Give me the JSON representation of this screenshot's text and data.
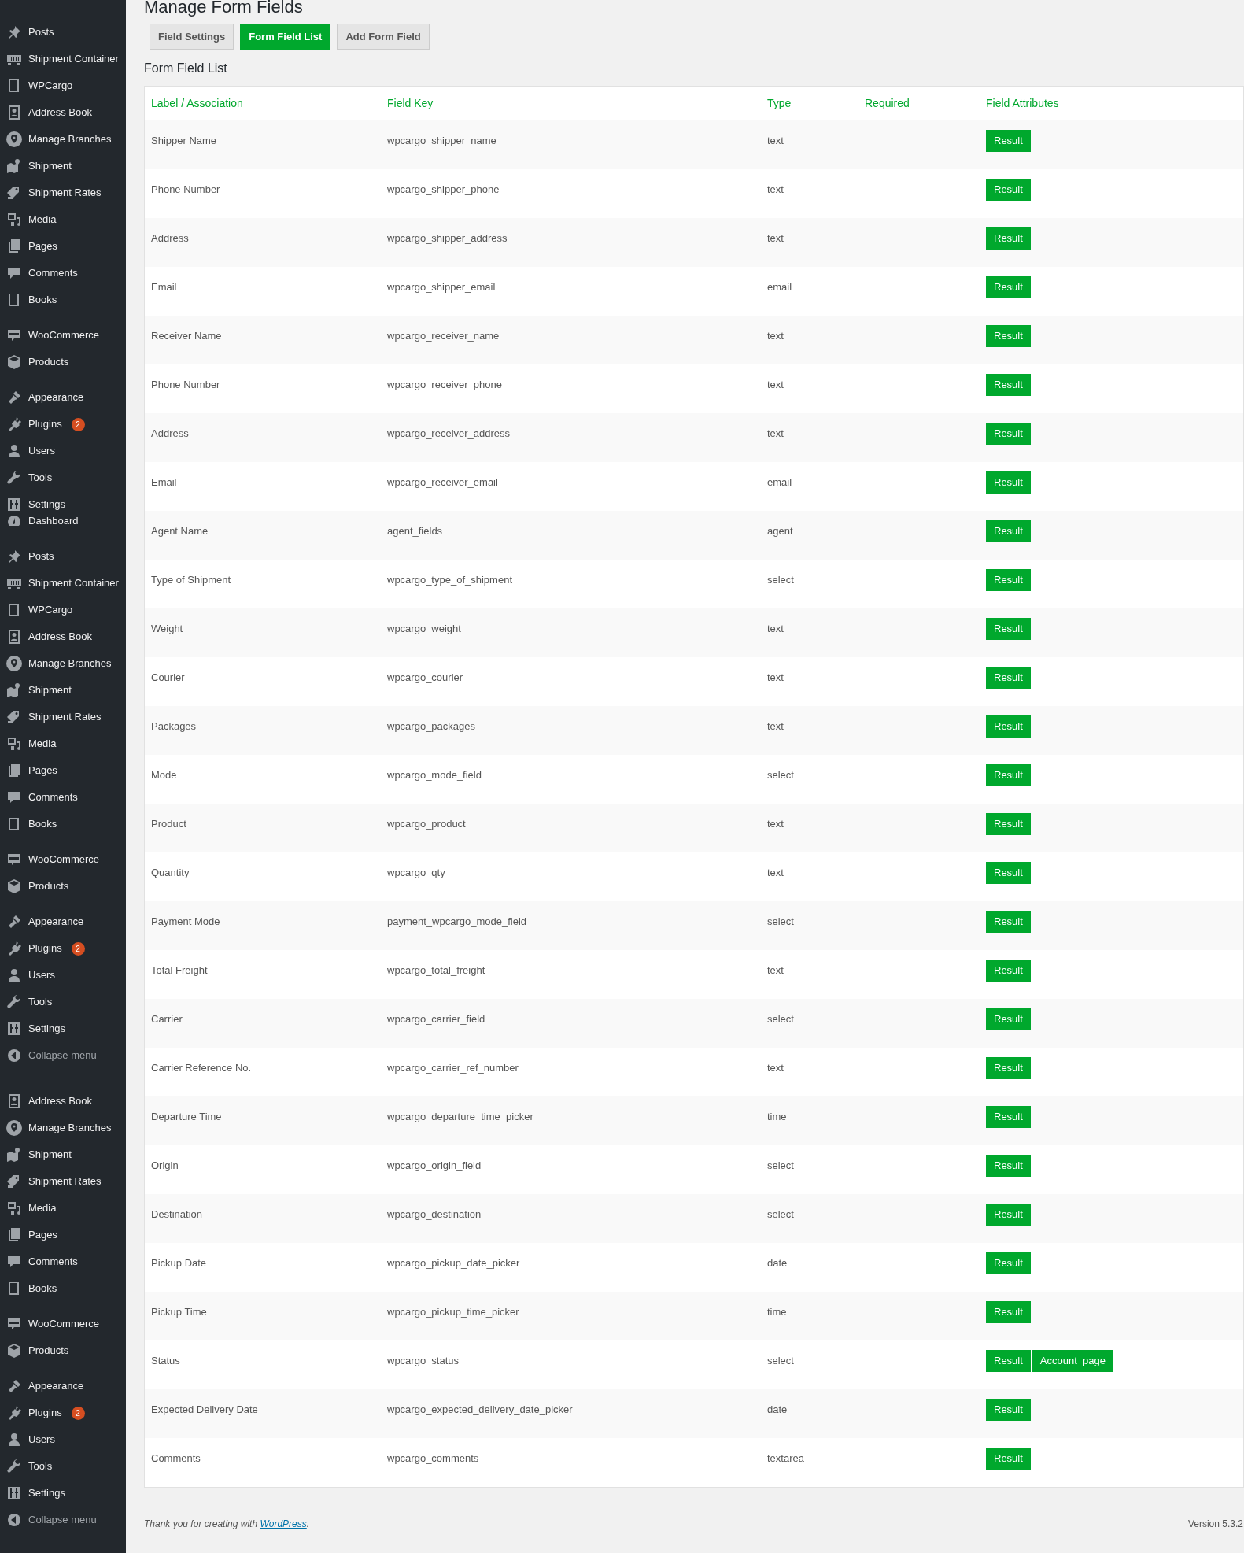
{
  "sidebar": {
    "menus": [
      {
        "groups": [
          {
            "items": [
              {
                "label": "Posts"
              },
              {
                "label": "Shipment Container"
              },
              {
                "label": "WPCargo"
              },
              {
                "label": "Address Book"
              },
              {
                "label": "Manage Branches"
              },
              {
                "label": "Shipment"
              },
              {
                "label": "Shipment Rates"
              },
              {
                "label": "Media"
              },
              {
                "label": "Pages"
              },
              {
                "label": "Comments"
              },
              {
                "label": "Books"
              }
            ]
          },
          {
            "items": [
              {
                "label": "WooCommerce"
              },
              {
                "label": "Products"
              }
            ]
          },
          {
            "items": [
              {
                "label": "Appearance"
              },
              {
                "label": "Plugins",
                "badge": "2"
              },
              {
                "label": "Users"
              },
              {
                "label": "Tools"
              },
              {
                "label": "Settings"
              }
            ]
          }
        ]
      },
      {
        "groups": [
          {
            "items": [
              {
                "label": "Dashboard"
              }
            ]
          },
          {
            "items": [
              {
                "label": "Posts"
              },
              {
                "label": "Shipment Container"
              },
              {
                "label": "WPCargo"
              },
              {
                "label": "Address Book"
              },
              {
                "label": "Manage Branches"
              },
              {
                "label": "Shipment"
              },
              {
                "label": "Shipment Rates"
              },
              {
                "label": "Media"
              },
              {
                "label": "Pages"
              },
              {
                "label": "Comments"
              },
              {
                "label": "Books"
              }
            ]
          },
          {
            "items": [
              {
                "label": "WooCommerce"
              },
              {
                "label": "Products"
              }
            ]
          },
          {
            "items": [
              {
                "label": "Appearance"
              },
              {
                "label": "Plugins",
                "badge": "2"
              },
              {
                "label": "Users"
              },
              {
                "label": "Tools"
              },
              {
                "label": "Settings"
              },
              {
                "label": "Collapse menu",
                "kind": "collapse"
              }
            ]
          }
        ]
      },
      {
        "groups": [
          {
            "items": [
              {
                "label": "Address Book"
              },
              {
                "label": "Manage Branches"
              },
              {
                "label": "Shipment"
              },
              {
                "label": "Shipment Rates"
              },
              {
                "label": "Media"
              },
              {
                "label": "Pages"
              },
              {
                "label": "Comments"
              },
              {
                "label": "Books"
              }
            ]
          },
          {
            "items": [
              {
                "label": "WooCommerce"
              },
              {
                "label": "Products"
              }
            ]
          },
          {
            "items": [
              {
                "label": "Appearance"
              },
              {
                "label": "Plugins",
                "badge": "2"
              },
              {
                "label": "Users"
              },
              {
                "label": "Tools"
              },
              {
                "label": "Settings"
              },
              {
                "label": "Collapse menu",
                "kind": "collapse"
              }
            ]
          }
        ]
      }
    ]
  },
  "page_title": "Manage Form Fields",
  "tabs": [
    {
      "label": "Field Settings",
      "selected": false
    },
    {
      "label": "Form Field List",
      "selected": true
    },
    {
      "label": "Add Form Field",
      "selected": false
    }
  ],
  "section_title": "Form Field List",
  "table": {
    "columns": [
      "Label / Association",
      "Field Key",
      "Type",
      "Required",
      "Field Attributes"
    ],
    "rows": [
      {
        "label": "Shipper Name",
        "key": "wpcargo_shipper_name",
        "type": "text",
        "attributes": [
          "Result"
        ]
      },
      {
        "label": "Phone Number",
        "key": "wpcargo_shipper_phone",
        "type": "text",
        "attributes": [
          "Result"
        ]
      },
      {
        "label": "Address",
        "key": "wpcargo_shipper_address",
        "type": "text",
        "attributes": [
          "Result"
        ]
      },
      {
        "label": "Email",
        "key": "wpcargo_shipper_email",
        "type": "email",
        "attributes": [
          "Result"
        ]
      },
      {
        "label": "Receiver Name",
        "key": "wpcargo_receiver_name",
        "type": "text",
        "attributes": [
          "Result"
        ]
      },
      {
        "label": "Phone Number",
        "key": "wpcargo_receiver_phone",
        "type": "text",
        "attributes": [
          "Result"
        ]
      },
      {
        "label": "Address",
        "key": "wpcargo_receiver_address",
        "type": "text",
        "attributes": [
          "Result"
        ]
      },
      {
        "label": "Email",
        "key": "wpcargo_receiver_email",
        "type": "email",
        "attributes": [
          "Result"
        ]
      },
      {
        "label": "Agent Name",
        "key": "agent_fields",
        "type": "agent",
        "attributes": [
          "Result"
        ]
      },
      {
        "label": "Type of Shipment",
        "key": "wpcargo_type_of_shipment",
        "type": "select",
        "attributes": [
          "Result"
        ]
      },
      {
        "label": "Weight",
        "key": "wpcargo_weight",
        "type": "text",
        "attributes": [
          "Result"
        ]
      },
      {
        "label": "Courier",
        "key": "wpcargo_courier",
        "type": "text",
        "attributes": [
          "Result"
        ]
      },
      {
        "label": "Packages",
        "key": "wpcargo_packages",
        "type": "text",
        "attributes": [
          "Result"
        ]
      },
      {
        "label": "Mode",
        "key": "wpcargo_mode_field",
        "type": "select",
        "attributes": [
          "Result"
        ]
      },
      {
        "label": "Product",
        "key": "wpcargo_product",
        "type": "text",
        "attributes": [
          "Result"
        ]
      },
      {
        "label": "Quantity",
        "key": "wpcargo_qty",
        "type": "text",
        "attributes": [
          "Result"
        ]
      },
      {
        "label": "Payment Mode",
        "key": "payment_wpcargo_mode_field",
        "type": "select",
        "attributes": [
          "Result"
        ]
      },
      {
        "label": "Total Freight",
        "key": "wpcargo_total_freight",
        "type": "text",
        "attributes": [
          "Result"
        ]
      },
      {
        "label": "Carrier",
        "key": "wpcargo_carrier_field",
        "type": "select",
        "attributes": [
          "Result"
        ]
      },
      {
        "label": "Carrier Reference No.",
        "key": "wpcargo_carrier_ref_number",
        "type": "text",
        "attributes": [
          "Result"
        ]
      },
      {
        "label": "Departure Time",
        "key": "wpcargo_departure_time_picker",
        "type": "time",
        "attributes": [
          "Result"
        ]
      },
      {
        "label": "Origin",
        "key": "wpcargo_origin_field",
        "type": "select",
        "attributes": [
          "Result"
        ]
      },
      {
        "label": "Destination",
        "key": "wpcargo_destination",
        "type": "select",
        "attributes": [
          "Result"
        ]
      },
      {
        "label": "Pickup Date",
        "key": "wpcargo_pickup_date_picker",
        "type": "date",
        "attributes": [
          "Result"
        ]
      },
      {
        "label": "Pickup Time",
        "key": "wpcargo_pickup_time_picker",
        "type": "time",
        "attributes": [
          "Result"
        ]
      },
      {
        "label": "Status",
        "key": "wpcargo_status",
        "type": "select",
        "attributes": [
          "Result",
          "Account_page"
        ]
      },
      {
        "label": "Expected Delivery Date",
        "key": "wpcargo_expected_delivery_date_picker",
        "type": "date",
        "attributes": [
          "Result"
        ]
      },
      {
        "label": "Comments",
        "key": "wpcargo_comments",
        "type": "textarea",
        "attributes": [
          "Result"
        ]
      }
    ]
  },
  "footer": {
    "text": "Thank you for creating with ",
    "link": "WordPress",
    "after": ".",
    "version": "Version 5.3.2"
  }
}
